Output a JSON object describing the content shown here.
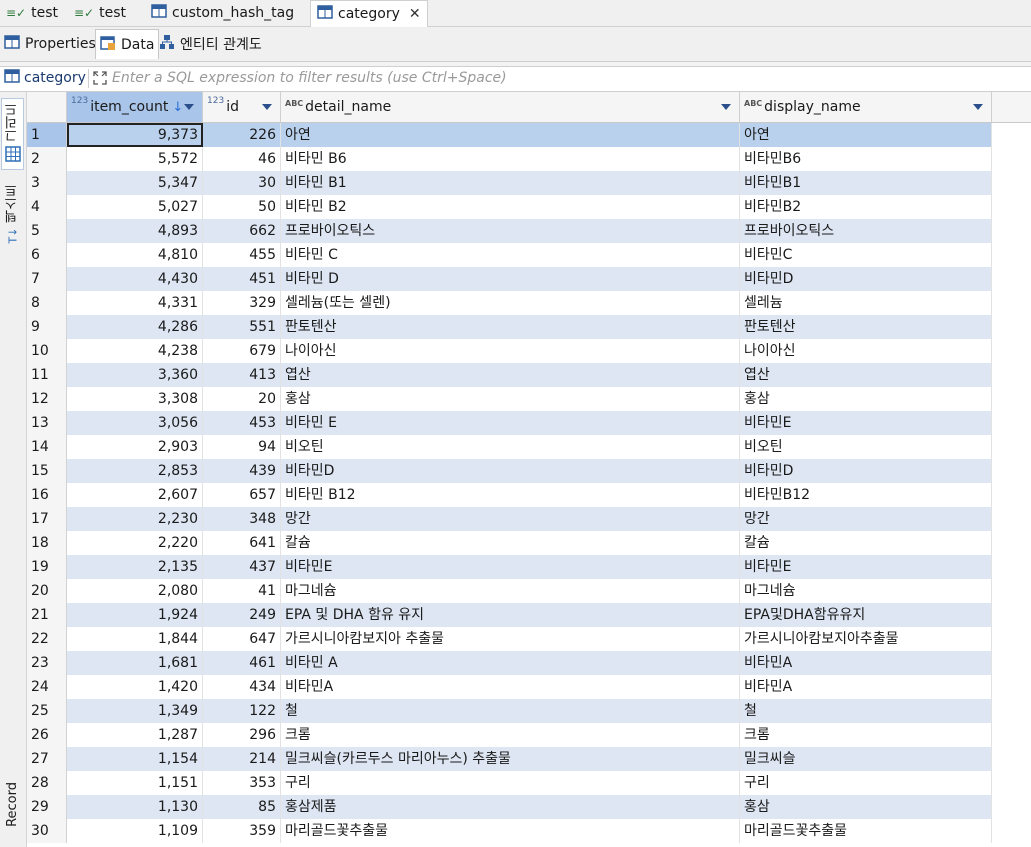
{
  "editor_tabs": [
    {
      "label": "test",
      "icon": "sql-script-icon",
      "active": false
    },
    {
      "label": "test",
      "icon": "sql-script-icon",
      "active": false
    },
    {
      "label": "custom_hash_tag",
      "icon": "table-icon",
      "active": false
    },
    {
      "label": "category",
      "icon": "table-icon",
      "active": true,
      "close": "✕"
    }
  ],
  "sub_tabs": [
    {
      "label": "Properties",
      "icon": "table-icon"
    },
    {
      "label": "Data",
      "icon": "data-icon"
    },
    {
      "label": "엔티티 관계도",
      "icon": "er-diagram-icon"
    }
  ],
  "filter": {
    "table_name": "category",
    "placeholder": "Enter a SQL expression to filter results (use Ctrl+Space)"
  },
  "side_panel": {
    "grid_label": "그리드",
    "text_label": "텍스트",
    "record_label": "Record"
  },
  "columns": [
    {
      "type": "123",
      "name": "item_count",
      "sorted": "desc"
    },
    {
      "type": "123",
      "name": "id"
    },
    {
      "type": "ABC",
      "name": "detail_name"
    },
    {
      "type": "ABC",
      "name": "display_name"
    }
  ],
  "rows": [
    {
      "n": "1",
      "count": "9,373",
      "id": "226",
      "detail": "아연",
      "display": "아연"
    },
    {
      "n": "2",
      "count": "5,572",
      "id": "46",
      "detail": "비타민 B6",
      "display": "비타민B6"
    },
    {
      "n": "3",
      "count": "5,347",
      "id": "30",
      "detail": "비타민 B1",
      "display": "비타민B1"
    },
    {
      "n": "4",
      "count": "5,027",
      "id": "50",
      "detail": "비타민 B2",
      "display": "비타민B2"
    },
    {
      "n": "5",
      "count": "4,893",
      "id": "662",
      "detail": "프로바이오틱스",
      "display": "프로바이오틱스"
    },
    {
      "n": "6",
      "count": "4,810",
      "id": "455",
      "detail": "비타민 C",
      "display": "비타민C"
    },
    {
      "n": "7",
      "count": "4,430",
      "id": "451",
      "detail": "비타민 D",
      "display": "비타민D"
    },
    {
      "n": "8",
      "count": "4,331",
      "id": "329",
      "detail": "셀레늄(또는 셀렌)",
      "display": "셀레늄"
    },
    {
      "n": "9",
      "count": "4,286",
      "id": "551",
      "detail": "판토텐산",
      "display": "판토텐산"
    },
    {
      "n": "10",
      "count": "4,238",
      "id": "679",
      "detail": "나이아신",
      "display": "나이아신"
    },
    {
      "n": "11",
      "count": "3,360",
      "id": "413",
      "detail": "엽산",
      "display": "엽산"
    },
    {
      "n": "12",
      "count": "3,308",
      "id": "20",
      "detail": "홍삼",
      "display": "홍삼"
    },
    {
      "n": "13",
      "count": "3,056",
      "id": "453",
      "detail": "비타민 E",
      "display": "비타민E"
    },
    {
      "n": "14",
      "count": "2,903",
      "id": "94",
      "detail": "비오틴",
      "display": "비오틴"
    },
    {
      "n": "15",
      "count": "2,853",
      "id": "439",
      "detail": "비타민D",
      "display": "비타민D"
    },
    {
      "n": "16",
      "count": "2,607",
      "id": "657",
      "detail": "비타민 B12",
      "display": "비타민B12"
    },
    {
      "n": "17",
      "count": "2,230",
      "id": "348",
      "detail": "망간",
      "display": "망간"
    },
    {
      "n": "18",
      "count": "2,220",
      "id": "641",
      "detail": "칼슘",
      "display": "칼슘"
    },
    {
      "n": "19",
      "count": "2,135",
      "id": "437",
      "detail": "비타민E",
      "display": "비타민E"
    },
    {
      "n": "20",
      "count": "2,080",
      "id": "41",
      "detail": "마그네슘",
      "display": "마그네슘"
    },
    {
      "n": "21",
      "count": "1,924",
      "id": "249",
      "detail": "EPA 및 DHA 함유 유지",
      "display": "EPA및DHA함유유지"
    },
    {
      "n": "22",
      "count": "1,844",
      "id": "647",
      "detail": "가르시니아캄보지아 추출물",
      "display": "가르시니아캄보지아추출물"
    },
    {
      "n": "23",
      "count": "1,681",
      "id": "461",
      "detail": "비타민 A",
      "display": "비타민A"
    },
    {
      "n": "24",
      "count": "1,420",
      "id": "434",
      "detail": "비타민A",
      "display": "비타민A"
    },
    {
      "n": "25",
      "count": "1,349",
      "id": "122",
      "detail": "철",
      "display": "철"
    },
    {
      "n": "26",
      "count": "1,287",
      "id": "296",
      "detail": "크롬",
      "display": "크롬"
    },
    {
      "n": "27",
      "count": "1,154",
      "id": "214",
      "detail": "밀크씨슬(카르두스 마리아누스) 추출물",
      "display": "밀크씨슬"
    },
    {
      "n": "28",
      "count": "1,151",
      "id": "353",
      "detail": "구리",
      "display": "구리"
    },
    {
      "n": "29",
      "count": "1,130",
      "id": "85",
      "detail": "홍삼제품",
      "display": "홍삼"
    },
    {
      "n": "30",
      "count": "1,109",
      "id": "359",
      "detail": "마리골드꽃추출물",
      "display": "마리골드꽃추출물"
    }
  ],
  "colors": {
    "selection": "#a9c6ea",
    "row_alt": "#dde6f2",
    "accent": "#2a6fd6"
  }
}
